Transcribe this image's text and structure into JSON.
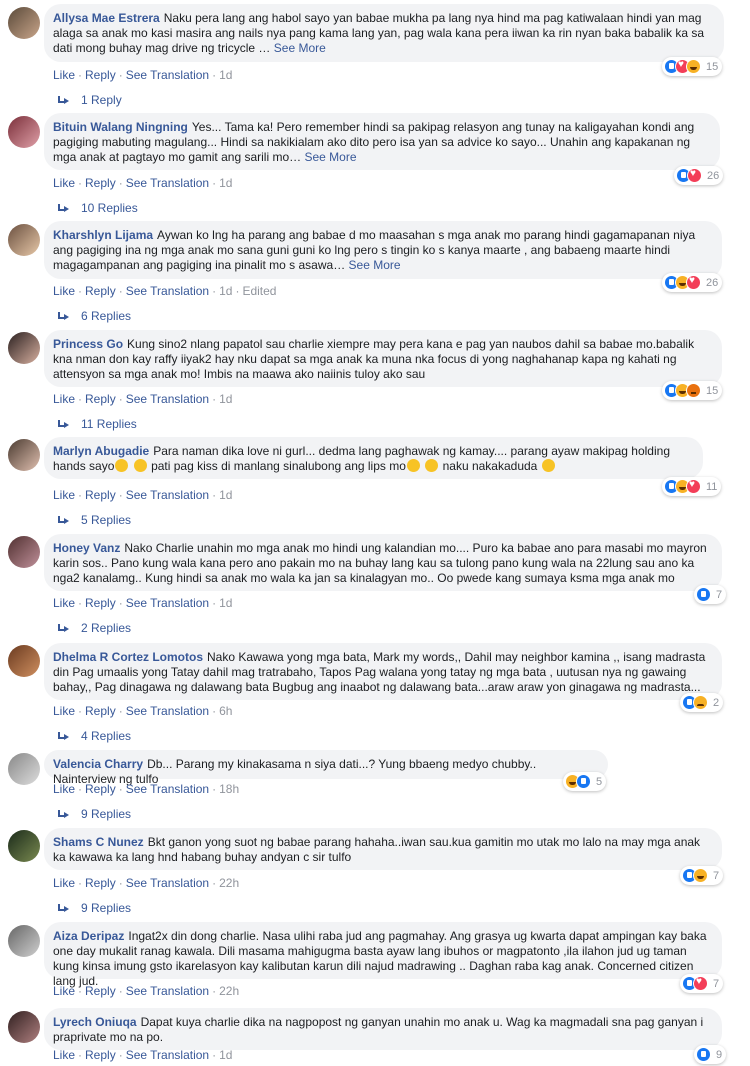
{
  "labels": {
    "like": "Like",
    "reply": "Reply",
    "see_translation": "See Translation",
    "see_more": "See More"
  },
  "comments": [
    {
      "author": "Allysa Mae Estrera",
      "text": "Naku pera lang ang habol sayo yan babae mukha pa lang nya hind ma pag katiwalaan hindi yan mag alaga sa anak mo kasi masira ang nails nya pang kama lang yan, pag wala kana pera iiwan ka rin nyan baka babalik ka sa dati mong buhay mag drive ng tricycle …",
      "see_more": true,
      "time": "1d",
      "edited": "",
      "reactions": [
        "like",
        "love",
        "haha"
      ],
      "reaction_count": "15",
      "replies": "1 Reply"
    },
    {
      "author": "Bituin Walang Ningning",
      "text": "Yes... Tama ka! Pero remember hindi sa pakipag relasyon ang tunay na kaligayahan kondi ang pagiging mabuting magulang... Hindi sa nakikialam ako dito pero isa yan sa advice ko sayo... Unahin ang kapakanan ng mga anak at pagtayo mo gamit ang sarili mo…",
      "see_more": true,
      "time": "1d",
      "edited": "",
      "reactions": [
        "like",
        "love"
      ],
      "reaction_count": "26",
      "replies": "10 Replies"
    },
    {
      "author": "Kharshlyn Lijama",
      "text": "Aywan ko lng ha parang ang babae d mo maasahan s mga anak mo parang hindi gagamapanan niya ang pagiging ina ng mga anak mo sana guni guni ko lng pero s tingin ko s kanya maarte , ang babaeng maarte hindi magagampanan ang pagiging ina pinalit mo s asawa…",
      "see_more": true,
      "time": "1d",
      "edited": "Edited",
      "reactions": [
        "like",
        "haha",
        "love"
      ],
      "reaction_count": "26",
      "replies": "6 Replies"
    },
    {
      "author": "Princess Go",
      "text": "Kung sino2 nlang papatol sau charlie xiempre may pera kana e pag yan naubos dahil sa babae mo.babalik kna nman don kay raffy iiyak2 hay nku dapat sa mga anak ka muna nka focus di yong naghahanap kapa ng kahati ng attensyon sa mga anak mo! Imbis na maawa ako naiinis tuloy ako sau",
      "see_more": false,
      "time": "1d",
      "edited": "",
      "reactions": [
        "like",
        "haha",
        "angry"
      ],
      "reaction_count": "15",
      "replies": "11 Replies"
    },
    {
      "author": "Marlyn Abugadie",
      "text": "Para naman dika love ni gurl... dedma lang paghawak ng kamay.... parang ayaw makipag holding hands sayo",
      "text2": "pati pag kiss di manlang sinalubong ang lips mo",
      "text3": "naku nakakaduda",
      "see_more": false,
      "time": "1d",
      "edited": "",
      "reactions": [
        "like",
        "haha",
        "love"
      ],
      "reaction_count": "11",
      "replies": "5 Replies"
    },
    {
      "author": "Honey Vanz",
      "text": "Nako Charlie unahin mo mga anak mo hindi ung kalandian mo.... Puro ka babae ano para masabi mo mayron karin sos.. Pano kung wala kana pero ano pakain mo na buhay lang kau sa tulong pano kung wala na 22lung sau ano ka nga2 kanalamg.. Kung hindi sa anak mo wala ka jan sa kinalagyan mo.. Oo pwede kang sumaya ksma mga anak mo",
      "see_more": false,
      "time": "1d",
      "edited": "",
      "reactions": [
        "like"
      ],
      "reaction_count": "7",
      "replies": "2 Replies"
    },
    {
      "author": "Dhelma R Cortez Lomotos",
      "text": "Nako Kawawa yong mga bata, Mark my words,, Dahil may neighbor kamina ,, isang madrasta din Pag umaalis yong Tatay dahil mag tratrabaho, Tapos Pag walana yong tatay ng mga bata , uutusan nya ng gawaing bahay,, Pag dinagawa ng dalawang bata Bugbug ang inaabot ng dalawang bata...araw araw yon ginagawa ng madrasta...",
      "see_more": false,
      "time": "6h",
      "edited": "",
      "reactions": [
        "like",
        "sad"
      ],
      "reaction_count": "2",
      "replies": "4 Replies"
    },
    {
      "author": "Valencia Charry",
      "text": "Db... Parang my kinakasama n siya dati...? Yung bbaeng medyo chubby.. Nainterview ng tulfo",
      "see_more": false,
      "time": "18h",
      "edited": "",
      "reactions": [
        "haha",
        "like"
      ],
      "reaction_count": "5",
      "replies": "9 Replies"
    },
    {
      "author": "Shams C Nunez",
      "text": "Bkt ganon yong suot ng babae parang hahaha..iwan sau.kua gamitin mo utak mo lalo na may mga anak ka kawawa ka lang hnd habang buhay andyan c sir tulfo",
      "see_more": false,
      "time": "22h",
      "edited": "",
      "reactions": [
        "like",
        "haha"
      ],
      "reaction_count": "7",
      "replies": "9 Replies"
    },
    {
      "author": "Aiza Deripaz",
      "text": "Ingat2x din dong charlie. Nasa ulihi raba jud ang pagmahay. Ang grasya ug kwarta dapat ampingan kay baka one day mukalit ranag kawala. Dili masama mahigugma basta ayaw lang ibuhos or magpatonto ,ila ilahon jud ug taman kung kinsa imung gsto ikarelasyon kay kalibutan karun dili najud madrawing .. Daghan raba kag anak. Concerned citizen lang jud.",
      "see_more": false,
      "time": "22h",
      "edited": "",
      "reactions": [
        "like",
        "love"
      ],
      "reaction_count": "7",
      "replies": ""
    },
    {
      "author": "Lyrech Oniuqa",
      "text": "Dapat kuya charlie dika na nagpopost ng ganyan unahin mo anak u. Wag ka magmadali sna pag ganyan i praprivate mo na po.",
      "see_more": false,
      "time": "1d",
      "edited": "",
      "reactions": [
        "like"
      ],
      "reaction_count": "9",
      "replies": ""
    }
  ],
  "colors": {
    "link": "#385898",
    "meta": "#90949c",
    "bubble": "#f2f3f5",
    "like": "#1877f2",
    "love": "#f33e58",
    "haha": "#f7b125",
    "angry": "#e9710f"
  }
}
